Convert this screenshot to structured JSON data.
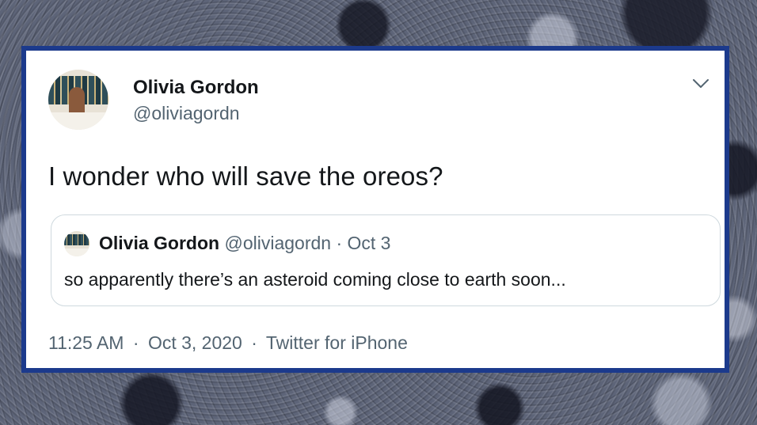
{
  "tweet": {
    "author_name": "Olivia Gordon",
    "author_handle": "@oliviagordn",
    "text": "I wonder who will save the oreos?",
    "timestamp_time": "11:25 AM",
    "timestamp_date": "Oct 3, 2020",
    "separator": "·",
    "source": "Twitter for iPhone"
  },
  "quoted_tweet": {
    "author_name": "Olivia Gordon",
    "author_handle": "@oliviagordn",
    "date": "Oct 3",
    "separator": "·",
    "text": "so apparently there’s an asteroid coming close to earth soon..."
  },
  "icons": {
    "menu": "chevron-down-icon",
    "avatar": "avatar",
    "quoted_avatar": "avatar"
  },
  "colors": {
    "border_accent": "#1c3a8c",
    "text_primary": "#14171a",
    "text_secondary": "#536471",
    "quote_border": "#cfd9de"
  }
}
